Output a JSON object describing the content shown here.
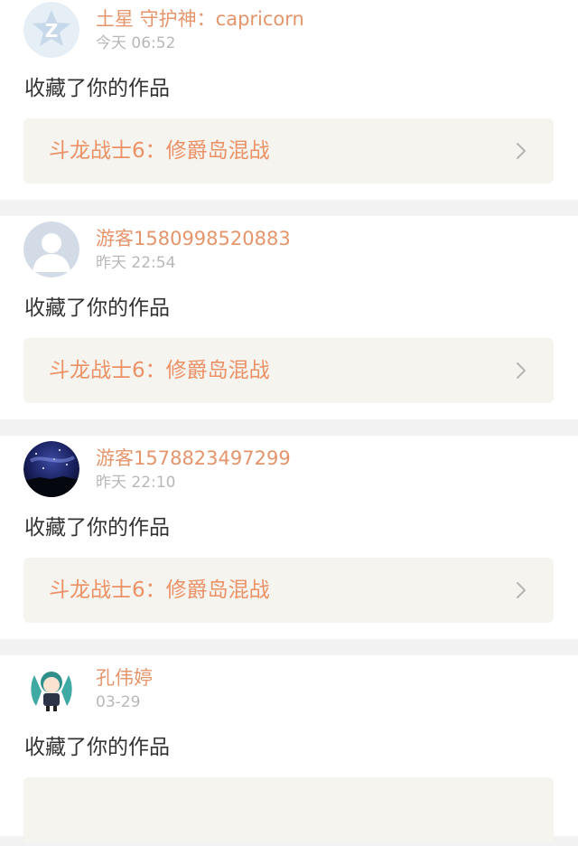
{
  "notifications": [
    {
      "avatar_icon": "qzone-icon",
      "username": "土星 守护神：capricorn",
      "time": "今天 06:52",
      "action": "收藏了你的作品",
      "work_title": "斗龙战士6：修爵岛混战"
    },
    {
      "avatar_icon": "default-user-icon",
      "username": "游客1580998520883",
      "time": "昨天 22:54",
      "action": "收藏了你的作品",
      "work_title": "斗龙战士6：修爵岛混战"
    },
    {
      "avatar_icon": "starry-sky-avatar",
      "username": "游客1578823497299",
      "time": "昨天 22:10",
      "action": "收藏了你的作品",
      "work_title": "斗龙战士6：修爵岛混战"
    },
    {
      "avatar_icon": "anime-girl-avatar",
      "username": "孔伟婷",
      "time": "03-29",
      "action": "收藏了你的作品",
      "work_title": ""
    }
  ],
  "colors": {
    "accent": "#e5956b",
    "link_text": "#ec9166",
    "timestamp": "#b8b8b8",
    "body_text": "#333333",
    "card_background": "#ffffff",
    "link_background": "#f5f4ef",
    "separator": "#f2f2f2"
  }
}
